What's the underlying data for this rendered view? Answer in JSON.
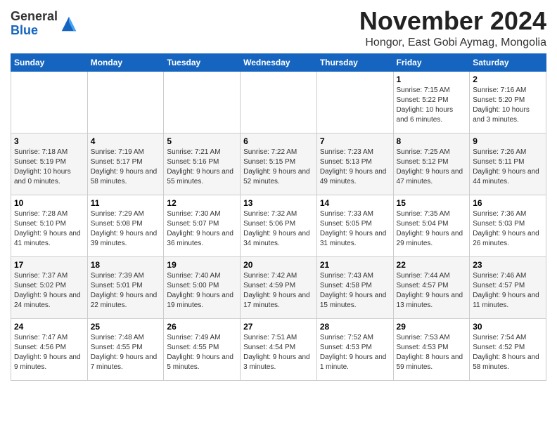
{
  "header": {
    "logo_line1": "General",
    "logo_line2": "Blue",
    "month": "November 2024",
    "location": "Hongor, East Gobi Aymag, Mongolia"
  },
  "weekdays": [
    "Sunday",
    "Monday",
    "Tuesday",
    "Wednesday",
    "Thursday",
    "Friday",
    "Saturday"
  ],
  "weeks": [
    [
      {
        "day": "",
        "info": ""
      },
      {
        "day": "",
        "info": ""
      },
      {
        "day": "",
        "info": ""
      },
      {
        "day": "",
        "info": ""
      },
      {
        "day": "",
        "info": ""
      },
      {
        "day": "1",
        "info": "Sunrise: 7:15 AM\nSunset: 5:22 PM\nDaylight: 10 hours\nand 6 minutes."
      },
      {
        "day": "2",
        "info": "Sunrise: 7:16 AM\nSunset: 5:20 PM\nDaylight: 10 hours\nand 3 minutes."
      }
    ],
    [
      {
        "day": "3",
        "info": "Sunrise: 7:18 AM\nSunset: 5:19 PM\nDaylight: 10 hours\nand 0 minutes."
      },
      {
        "day": "4",
        "info": "Sunrise: 7:19 AM\nSunset: 5:17 PM\nDaylight: 9 hours\nand 58 minutes."
      },
      {
        "day": "5",
        "info": "Sunrise: 7:21 AM\nSunset: 5:16 PM\nDaylight: 9 hours\nand 55 minutes."
      },
      {
        "day": "6",
        "info": "Sunrise: 7:22 AM\nSunset: 5:15 PM\nDaylight: 9 hours\nand 52 minutes."
      },
      {
        "day": "7",
        "info": "Sunrise: 7:23 AM\nSunset: 5:13 PM\nDaylight: 9 hours\nand 49 minutes."
      },
      {
        "day": "8",
        "info": "Sunrise: 7:25 AM\nSunset: 5:12 PM\nDaylight: 9 hours\nand 47 minutes."
      },
      {
        "day": "9",
        "info": "Sunrise: 7:26 AM\nSunset: 5:11 PM\nDaylight: 9 hours\nand 44 minutes."
      }
    ],
    [
      {
        "day": "10",
        "info": "Sunrise: 7:28 AM\nSunset: 5:10 PM\nDaylight: 9 hours\nand 41 minutes."
      },
      {
        "day": "11",
        "info": "Sunrise: 7:29 AM\nSunset: 5:08 PM\nDaylight: 9 hours\nand 39 minutes."
      },
      {
        "day": "12",
        "info": "Sunrise: 7:30 AM\nSunset: 5:07 PM\nDaylight: 9 hours\nand 36 minutes."
      },
      {
        "day": "13",
        "info": "Sunrise: 7:32 AM\nSunset: 5:06 PM\nDaylight: 9 hours\nand 34 minutes."
      },
      {
        "day": "14",
        "info": "Sunrise: 7:33 AM\nSunset: 5:05 PM\nDaylight: 9 hours\nand 31 minutes."
      },
      {
        "day": "15",
        "info": "Sunrise: 7:35 AM\nSunset: 5:04 PM\nDaylight: 9 hours\nand 29 minutes."
      },
      {
        "day": "16",
        "info": "Sunrise: 7:36 AM\nSunset: 5:03 PM\nDaylight: 9 hours\nand 26 minutes."
      }
    ],
    [
      {
        "day": "17",
        "info": "Sunrise: 7:37 AM\nSunset: 5:02 PM\nDaylight: 9 hours\nand 24 minutes."
      },
      {
        "day": "18",
        "info": "Sunrise: 7:39 AM\nSunset: 5:01 PM\nDaylight: 9 hours\nand 22 minutes."
      },
      {
        "day": "19",
        "info": "Sunrise: 7:40 AM\nSunset: 5:00 PM\nDaylight: 9 hours\nand 19 minutes."
      },
      {
        "day": "20",
        "info": "Sunrise: 7:42 AM\nSunset: 4:59 PM\nDaylight: 9 hours\nand 17 minutes."
      },
      {
        "day": "21",
        "info": "Sunrise: 7:43 AM\nSunset: 4:58 PM\nDaylight: 9 hours\nand 15 minutes."
      },
      {
        "day": "22",
        "info": "Sunrise: 7:44 AM\nSunset: 4:57 PM\nDaylight: 9 hours\nand 13 minutes."
      },
      {
        "day": "23",
        "info": "Sunrise: 7:46 AM\nSunset: 4:57 PM\nDaylight: 9 hours\nand 11 minutes."
      }
    ],
    [
      {
        "day": "24",
        "info": "Sunrise: 7:47 AM\nSunset: 4:56 PM\nDaylight: 9 hours\nand 9 minutes."
      },
      {
        "day": "25",
        "info": "Sunrise: 7:48 AM\nSunset: 4:55 PM\nDaylight: 9 hours\nand 7 minutes."
      },
      {
        "day": "26",
        "info": "Sunrise: 7:49 AM\nSunset: 4:55 PM\nDaylight: 9 hours\nand 5 minutes."
      },
      {
        "day": "27",
        "info": "Sunrise: 7:51 AM\nSunset: 4:54 PM\nDaylight: 9 hours\nand 3 minutes."
      },
      {
        "day": "28",
        "info": "Sunrise: 7:52 AM\nSunset: 4:53 PM\nDaylight: 9 hours\nand 1 minute."
      },
      {
        "day": "29",
        "info": "Sunrise: 7:53 AM\nSunset: 4:53 PM\nDaylight: 8 hours\nand 59 minutes."
      },
      {
        "day": "30",
        "info": "Sunrise: 7:54 AM\nSunset: 4:52 PM\nDaylight: 8 hours\nand 58 minutes."
      }
    ]
  ]
}
